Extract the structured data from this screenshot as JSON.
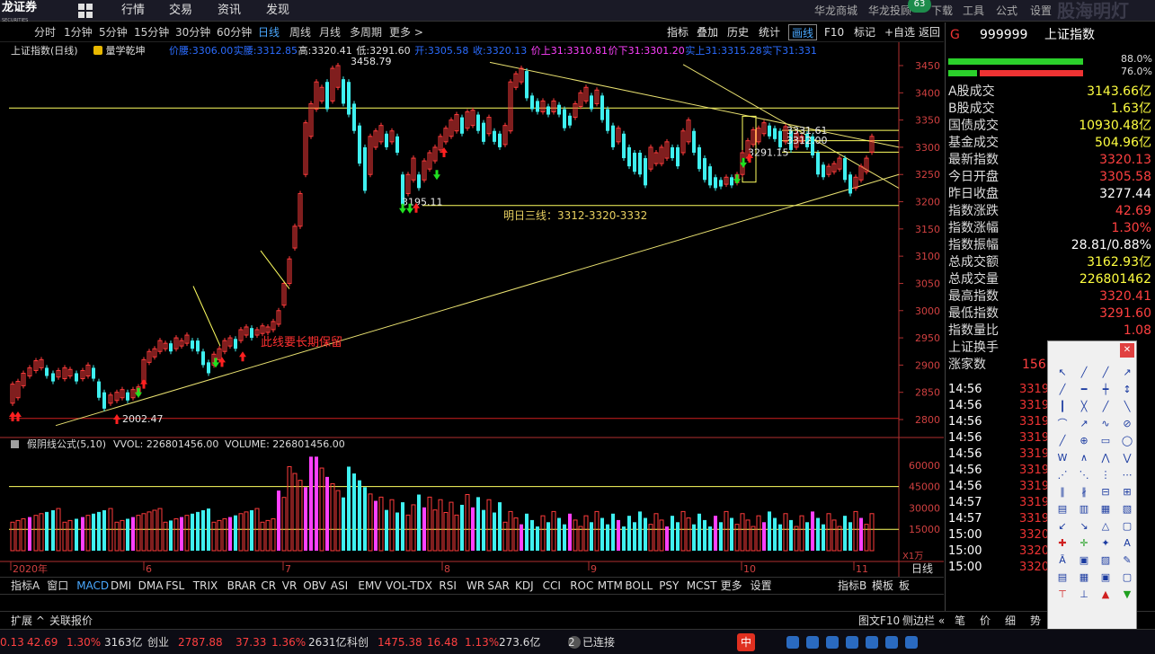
{
  "app": {
    "logo_text": "龙证券",
    "logo_sub": "SECURITIES",
    "menu": [
      "行情",
      "交易",
      "资讯",
      "发现"
    ],
    "right_menu": [
      "华龙商城",
      "华龙投顾",
      "下载",
      "工具",
      "公式",
      "设置"
    ],
    "badge": "63",
    "brand": "股海明灯"
  },
  "periods": [
    "分时",
    "1分钟",
    "5分钟",
    "15分钟",
    "30分钟",
    "60分钟",
    "日线",
    "周线",
    "月线",
    "多周期",
    "更多 >"
  ],
  "active_period": "日线",
  "toolbar_buttons": [
    "指标",
    "叠加",
    "历史",
    "统计",
    "画线",
    "F10",
    "标记",
    "+自选",
    "返回"
  ],
  "chart_info": {
    "title": "上证指数(日线)",
    "icon_label": "量学乾坤",
    "fields": [
      {
        "label": "价腰:",
        "value": "3306.00",
        "color": "#2b6cff"
      },
      {
        "label": "实腰:",
        "value": "3312.85",
        "color": "#2b6cff"
      },
      {
        "label": "高:",
        "value": "3320.41",
        "color": "#e0e0e0"
      },
      {
        "label": "低:",
        "value": "3291.60",
        "color": "#e0e0e0"
      },
      {
        "label": "开:",
        "value": "3305.58",
        "color": "#2b6cff"
      },
      {
        "label": "收:",
        "value": "3320.13",
        "color": "#2b6cff"
      },
      {
        "label": "价上31:",
        "value": "3310.81",
        "color": "#ff40ff"
      },
      {
        "label": "价下31:",
        "value": "3301.20",
        "color": "#ff40ff"
      },
      {
        "label": "实上31:",
        "value": "3315.28",
        "color": "#2b6cff"
      },
      {
        "label": "实下31:",
        "value": "331",
        "color": "#2b6cff"
      }
    ]
  },
  "price_axis": [
    "3450",
    "3400",
    "3350",
    "3300",
    "3250",
    "3200",
    "3150",
    "3100",
    "3050",
    "3000",
    "2950",
    "2900",
    "2850",
    "2800"
  ],
  "vol_axis": [
    "60000",
    "45000",
    "30000",
    "15000"
  ],
  "vol_unit": "X1万",
  "annotations": {
    "high": "3458.79",
    "low": "2002.47",
    "mid_low": "3195.11",
    "box_high": "3331.61",
    "box_mid": "3312.00",
    "box_low": "3291.15",
    "note_tomorrow": "明日三线：3312-3320-3332",
    "note_line": "此线要长期保留"
  },
  "vol_info": {
    "title": "假阴线公式(5,10)",
    "vvol": "VVOL: 226801456.00",
    "volume": "VOLUME: 226801456.00"
  },
  "date_axis": [
    "2020年",
    "6",
    "7",
    "8",
    "9",
    "10",
    "11"
  ],
  "date_axis_right": "日线",
  "indicator_tabs": [
    "指标A",
    "窗口",
    "MACD",
    "DMI",
    "DMA",
    "FSL",
    "TRIX",
    "BRAR",
    "CR",
    "VR",
    "OBV",
    "ASI",
    "EMV",
    "VOL-TDX",
    "RSI",
    "WR",
    "SAR",
    "KDJ",
    "CCI",
    "ROC",
    "MTM",
    "BOLL",
    "PSY",
    "MCST",
    "更多",
    "设置"
  ],
  "indicator_right": [
    "指标B",
    "模板",
    "板"
  ],
  "ext_tabs": [
    "扩展 ^",
    "关联报价"
  ],
  "ext_right": [
    "图文F10",
    "侧边栏 «"
  ],
  "right_panel": {
    "flag": "G",
    "code": "999999",
    "name": "上证指数",
    "bar1_pct": "88.0%",
    "bar2_pct": "76.0%",
    "rows": [
      {
        "k": "A股成交",
        "v": "3143.66亿",
        "c": "#ffff40"
      },
      {
        "k": "B股成交",
        "v": "1.63亿",
        "c": "#ffff40"
      },
      {
        "k": "国债成交",
        "v": "10930.48亿",
        "c": "#ffff40"
      },
      {
        "k": "基金成交",
        "v": "504.96亿",
        "c": "#ffff40"
      },
      {
        "k": "最新指数",
        "v": "3320.13",
        "c": "#ff4040"
      },
      {
        "k": "今日开盘",
        "v": "3305.58",
        "c": "#ff4040"
      },
      {
        "k": "昨日收盘",
        "v": "3277.44",
        "c": "#ffffff"
      },
      {
        "k": "指数涨跌",
        "v": "42.69",
        "c": "#ff4040"
      },
      {
        "k": "指数涨幅",
        "v": "1.30%",
        "c": "#ff4040"
      },
      {
        "k": "指数振幅",
        "v": "28.81/0.88%",
        "c": "#ffffff"
      },
      {
        "k": "总成交额",
        "v": "3162.93亿",
        "c": "#ffff40"
      },
      {
        "k": "总成交量",
        "v": "226801462",
        "c": "#ffff40"
      },
      {
        "k": "最高指数",
        "v": "3320.41",
        "c": "#ff4040"
      },
      {
        "k": "最低指数",
        "v": "3291.60",
        "c": "#ff4040"
      },
      {
        "k": "指数量比",
        "v": "1.08",
        "c": "#ff4040"
      },
      {
        "k": "上证换手",
        "v": "",
        "c": "#ffffff"
      },
      {
        "k": "涨家数",
        "v": "156",
        "c": "#ff4040"
      }
    ],
    "ticks": [
      {
        "t": "14:56",
        "v": "3319"
      },
      {
        "t": "14:56",
        "v": "3319"
      },
      {
        "t": "14:56",
        "v": "3319"
      },
      {
        "t": "14:56",
        "v": "3319"
      },
      {
        "t": "14:56",
        "v": "3319"
      },
      {
        "t": "14:56",
        "v": "3319"
      },
      {
        "t": "14:56",
        "v": "3319"
      },
      {
        "t": "14:57",
        "v": "3319"
      },
      {
        "t": "14:57",
        "v": "3319"
      },
      {
        "t": "15:00",
        "v": "3320"
      },
      {
        "t": "15:00",
        "v": "3320"
      },
      {
        "t": "15:00",
        "v": "3320"
      }
    ],
    "bottom_tabs": [
      "笔",
      "价",
      "细",
      "势"
    ]
  },
  "statusbar": [
    {
      "t": "0.13",
      "c": "#ff4040"
    },
    {
      "t": "42.69",
      "c": "#ff4040"
    },
    {
      "t": "1.30%",
      "c": "#ff4040"
    },
    {
      "t": "3163亿",
      "c": "#ddd"
    },
    {
      "t": "创业",
      "c": "#ddd"
    },
    {
      "t": "2787.88",
      "c": "#ff4040"
    },
    {
      "t": "37.33",
      "c": "#ff4040"
    },
    {
      "t": "1.36%",
      "c": "#ff4040"
    },
    {
      "t": "2631亿",
      "c": "#ddd"
    },
    {
      "t": "科创",
      "c": "#ddd"
    },
    {
      "t": "1475.38",
      "c": "#ff4040"
    },
    {
      "t": "16.48",
      "c": "#ff4040"
    },
    {
      "t": "1.13%",
      "c": "#ff4040"
    },
    {
      "t": "273.6亿",
      "c": "#ddd"
    },
    {
      "t": "2",
      "c": "#ddd"
    },
    {
      "t": "已连接",
      "c": "#ddd"
    }
  ],
  "ime": "中",
  "colors": {
    "up": "#ff3b3b",
    "down": "#3ff0f0",
    "accent": "#ffff60",
    "trend": "#e8e070"
  }
}
